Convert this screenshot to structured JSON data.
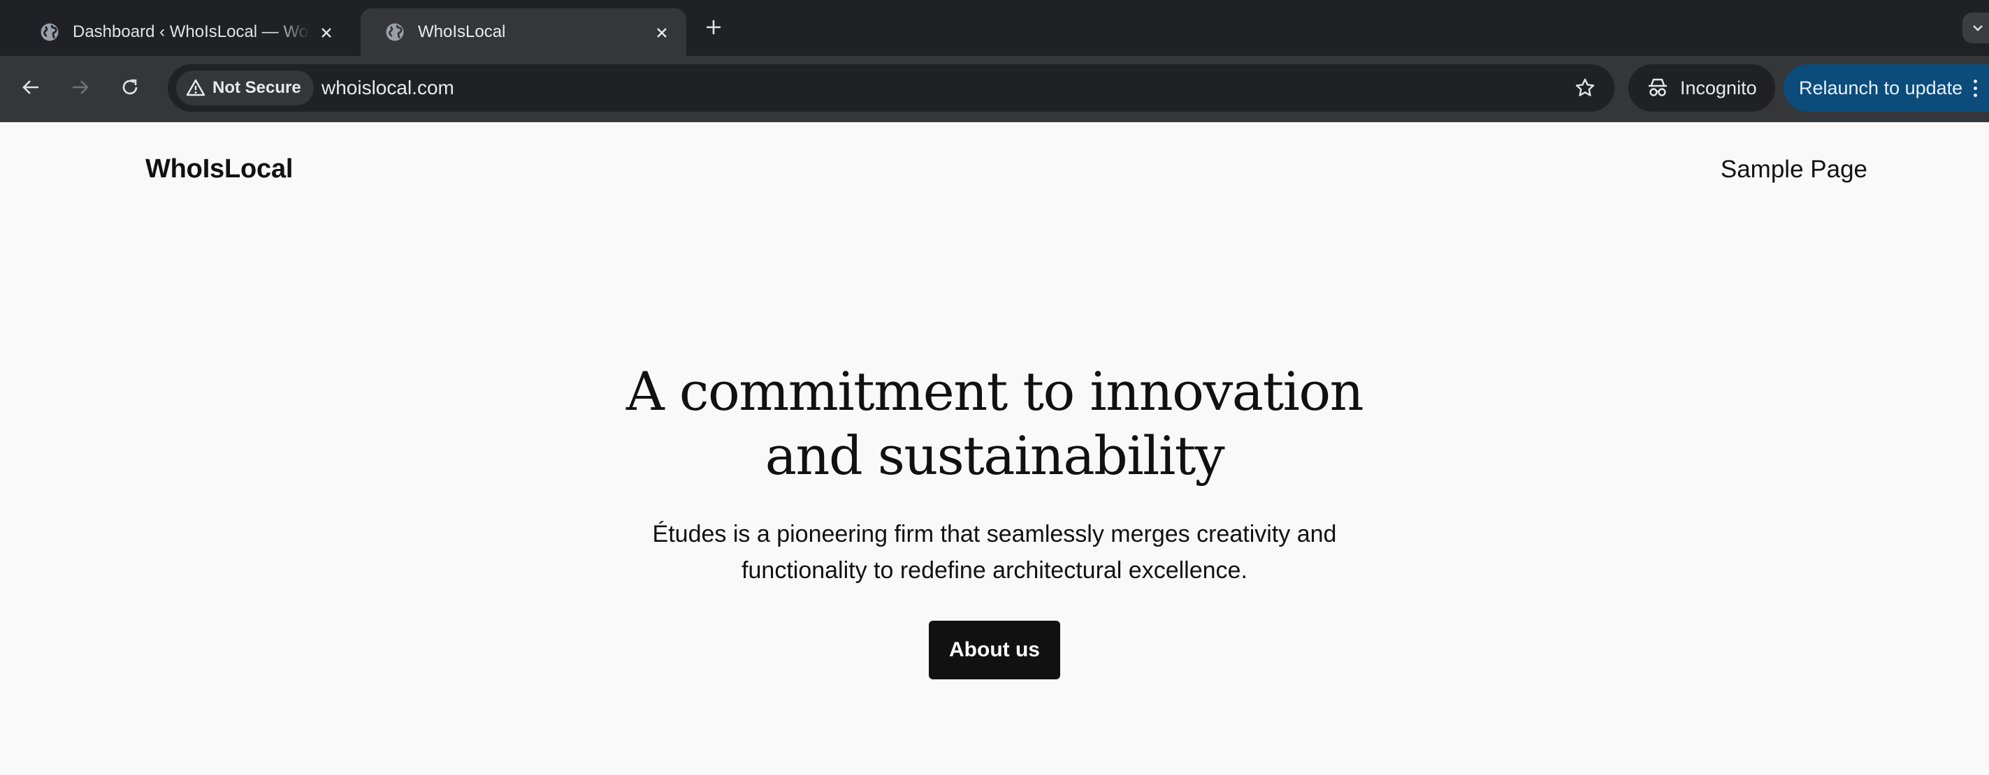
{
  "browser": {
    "tabs": [
      {
        "title": "Dashboard ‹ WhoIsLocal — WordPress",
        "active": false
      },
      {
        "title": "WhoIsLocal",
        "active": true
      }
    ],
    "security_chip": "Not Secure",
    "url": "whoislocal.com",
    "profile_label": "Incognito",
    "relaunch_label": "Relaunch to update",
    "accent_color": "#0b4c7a"
  },
  "site": {
    "title": "WhoIsLocal",
    "nav": [
      "Sample Page"
    ]
  },
  "hero": {
    "heading_line1": "A commitment to innovation",
    "heading_line2": "and sustainability",
    "text_line1": "Études is a pioneering firm that seamlessly merges creativity and",
    "text_line2": "functionality to redefine architectural excellence.",
    "button_label": "About us"
  },
  "icons": [
    "globe-icon",
    "close-icon",
    "plus-icon",
    "back-arrow-icon",
    "forward-arrow-icon",
    "reload-icon",
    "warning-triangle-icon",
    "star-icon",
    "incognito-icon",
    "more-vert-icon",
    "chevron-down-icon"
  ]
}
